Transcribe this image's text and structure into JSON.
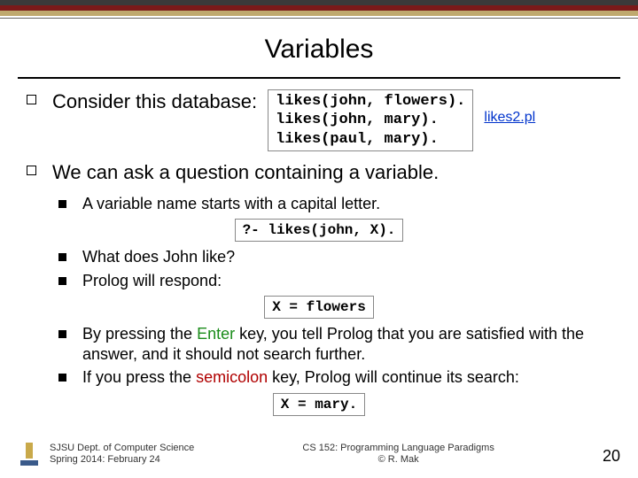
{
  "title": "Variables",
  "bullet1": {
    "lead": "Consider this database:",
    "code": "likes(john, flowers).\nlikes(john, mary).\nlikes(paul, mary).",
    "link": "likes2.pl"
  },
  "bullet2": {
    "lead": "We can ask a question containing a variable.",
    "sub1": "A variable name starts with a capital letter.",
    "query": "?- likes(john, X).",
    "sub2": "What does John like?",
    "sub3": "Prolog will respond:",
    "resp1": "X = flowers",
    "sub4_pre": "By pressing the ",
    "sub4_key": "Enter",
    "sub4_post": " key, you tell Prolog that you are satisfied with the answer, and it should not search further.",
    "sub5_pre": "If you press the ",
    "sub5_key": "semicolon",
    "sub5_post": " key, Prolog will continue its search:",
    "resp2": "X = mary."
  },
  "footer": {
    "left1": "SJSU Dept. of Computer Science",
    "left2": "Spring 2014: February 24",
    "center1": "CS 152: Programming Language Paradigms",
    "center2": "© R. Mak",
    "page": "20"
  }
}
